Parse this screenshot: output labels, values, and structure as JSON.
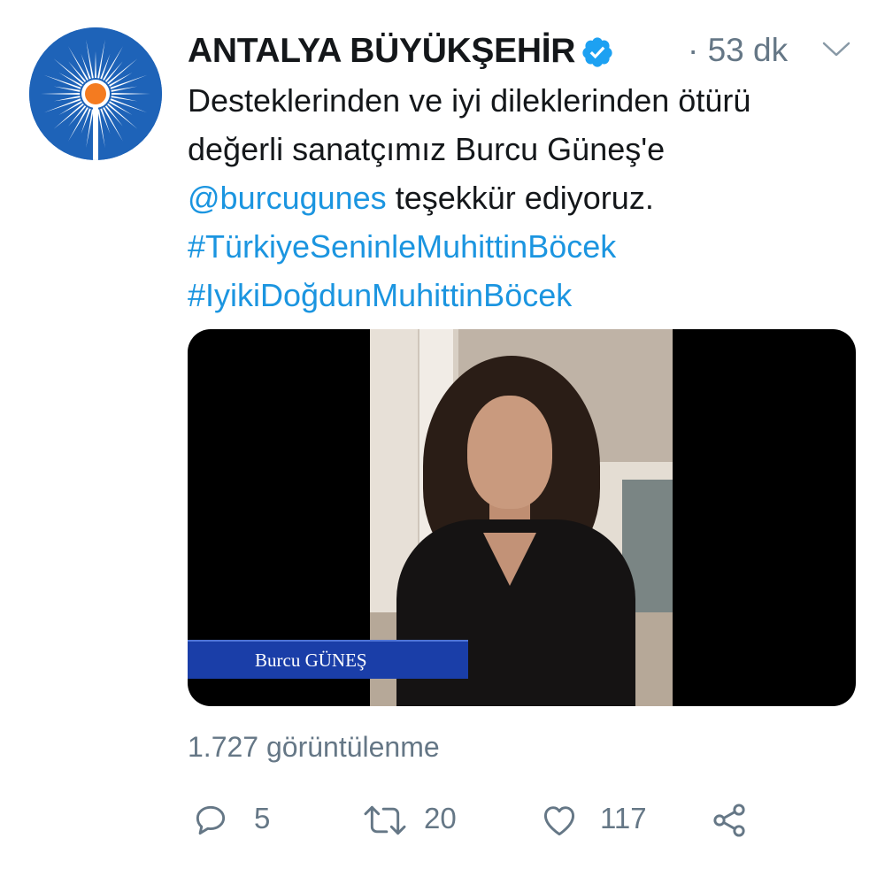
{
  "colors": {
    "brand_blue": "#1e63b8",
    "sun_orange": "#f47b20",
    "link_blue": "#1b95e0",
    "muted_gray": "#657786",
    "lower_third_blue": "#1a3ea8"
  },
  "tweet": {
    "author_name": "ANTALYA BÜYÜKŞEHİR",
    "verified_icon": "verified-badge-icon",
    "time": "· 53 dk",
    "menu_icon": "chevron-down-icon",
    "text": {
      "line1": "Desteklerinden ve iyi dileklerinden ötürü",
      "line2": "değerli sanatçımız Burcu Güneş'e",
      "mention": "@burcugunes",
      "line3_rest": " teşekkür ediyoruz.",
      "hashtag1": "#TürkiyeSeninleMuhittinBöcek",
      "hashtag2": "#IyikiDoğdunMuhittinBöcek"
    },
    "video": {
      "lower_third": "Burcu GÜNEŞ"
    },
    "views": "1.727 görüntülenme",
    "actions": {
      "reply": {
        "icon": "reply-icon",
        "count": "5"
      },
      "retweet": {
        "icon": "retweet-icon",
        "count": "20"
      },
      "like": {
        "icon": "heart-icon",
        "count": "117"
      },
      "share": {
        "icon": "share-icon"
      }
    }
  }
}
